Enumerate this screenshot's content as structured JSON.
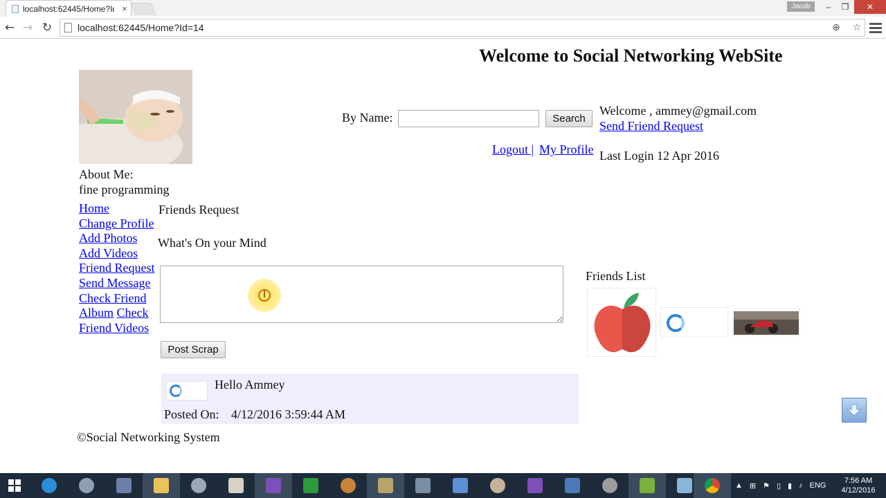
{
  "browser": {
    "tab_title": "localhost:62445/Home?Id",
    "tab_close": "×",
    "user_name": "Jacob",
    "url": "localhost:62445/Home?Id=14"
  },
  "header": {
    "site_title": "Welcome to Social Networking WebSite"
  },
  "search": {
    "label": "By Name:",
    "value": "",
    "button": "Search"
  },
  "user": {
    "welcome_prefix": "Welcome ,",
    "email": "ammey@gmail.com",
    "send_friend_request": "Send Friend Request",
    "logout": "Logout |",
    "my_profile": "My Profile",
    "last_login": "Last Login 12 Apr 2016"
  },
  "profile": {
    "about_label": "About Me:",
    "about_text": "fine programming"
  },
  "nav": {
    "home": "Home",
    "change_profile": "Change Profile",
    "add_photos": "Add Photos",
    "add_videos": "Add Videos",
    "friend_request": "Friend Request",
    "send_message": "Send Message",
    "check_friend_album": "Check Friend Album",
    "check_friend_videos": "Check Friend Videos"
  },
  "main": {
    "friends_request_title": "Friends Request",
    "whats_on_mind": "What's On your Mind",
    "mind_value": "",
    "post_button": "Post Scrap"
  },
  "scrap": {
    "message": "Hello Ammey",
    "posted_label": "Posted On:",
    "posted_value": "4/12/2016 3:59:44 AM"
  },
  "friends": {
    "title": "Friends List"
  },
  "footer": {
    "copyright": "©Social Networking System"
  },
  "taskbar": {
    "language": "ENG",
    "time": "7:56 AM",
    "date": "4/12/2016"
  },
  "colors": {
    "link": "#0000ee",
    "scrap_bg": "#eeeeff",
    "taskbar": "#1e2b3a"
  }
}
